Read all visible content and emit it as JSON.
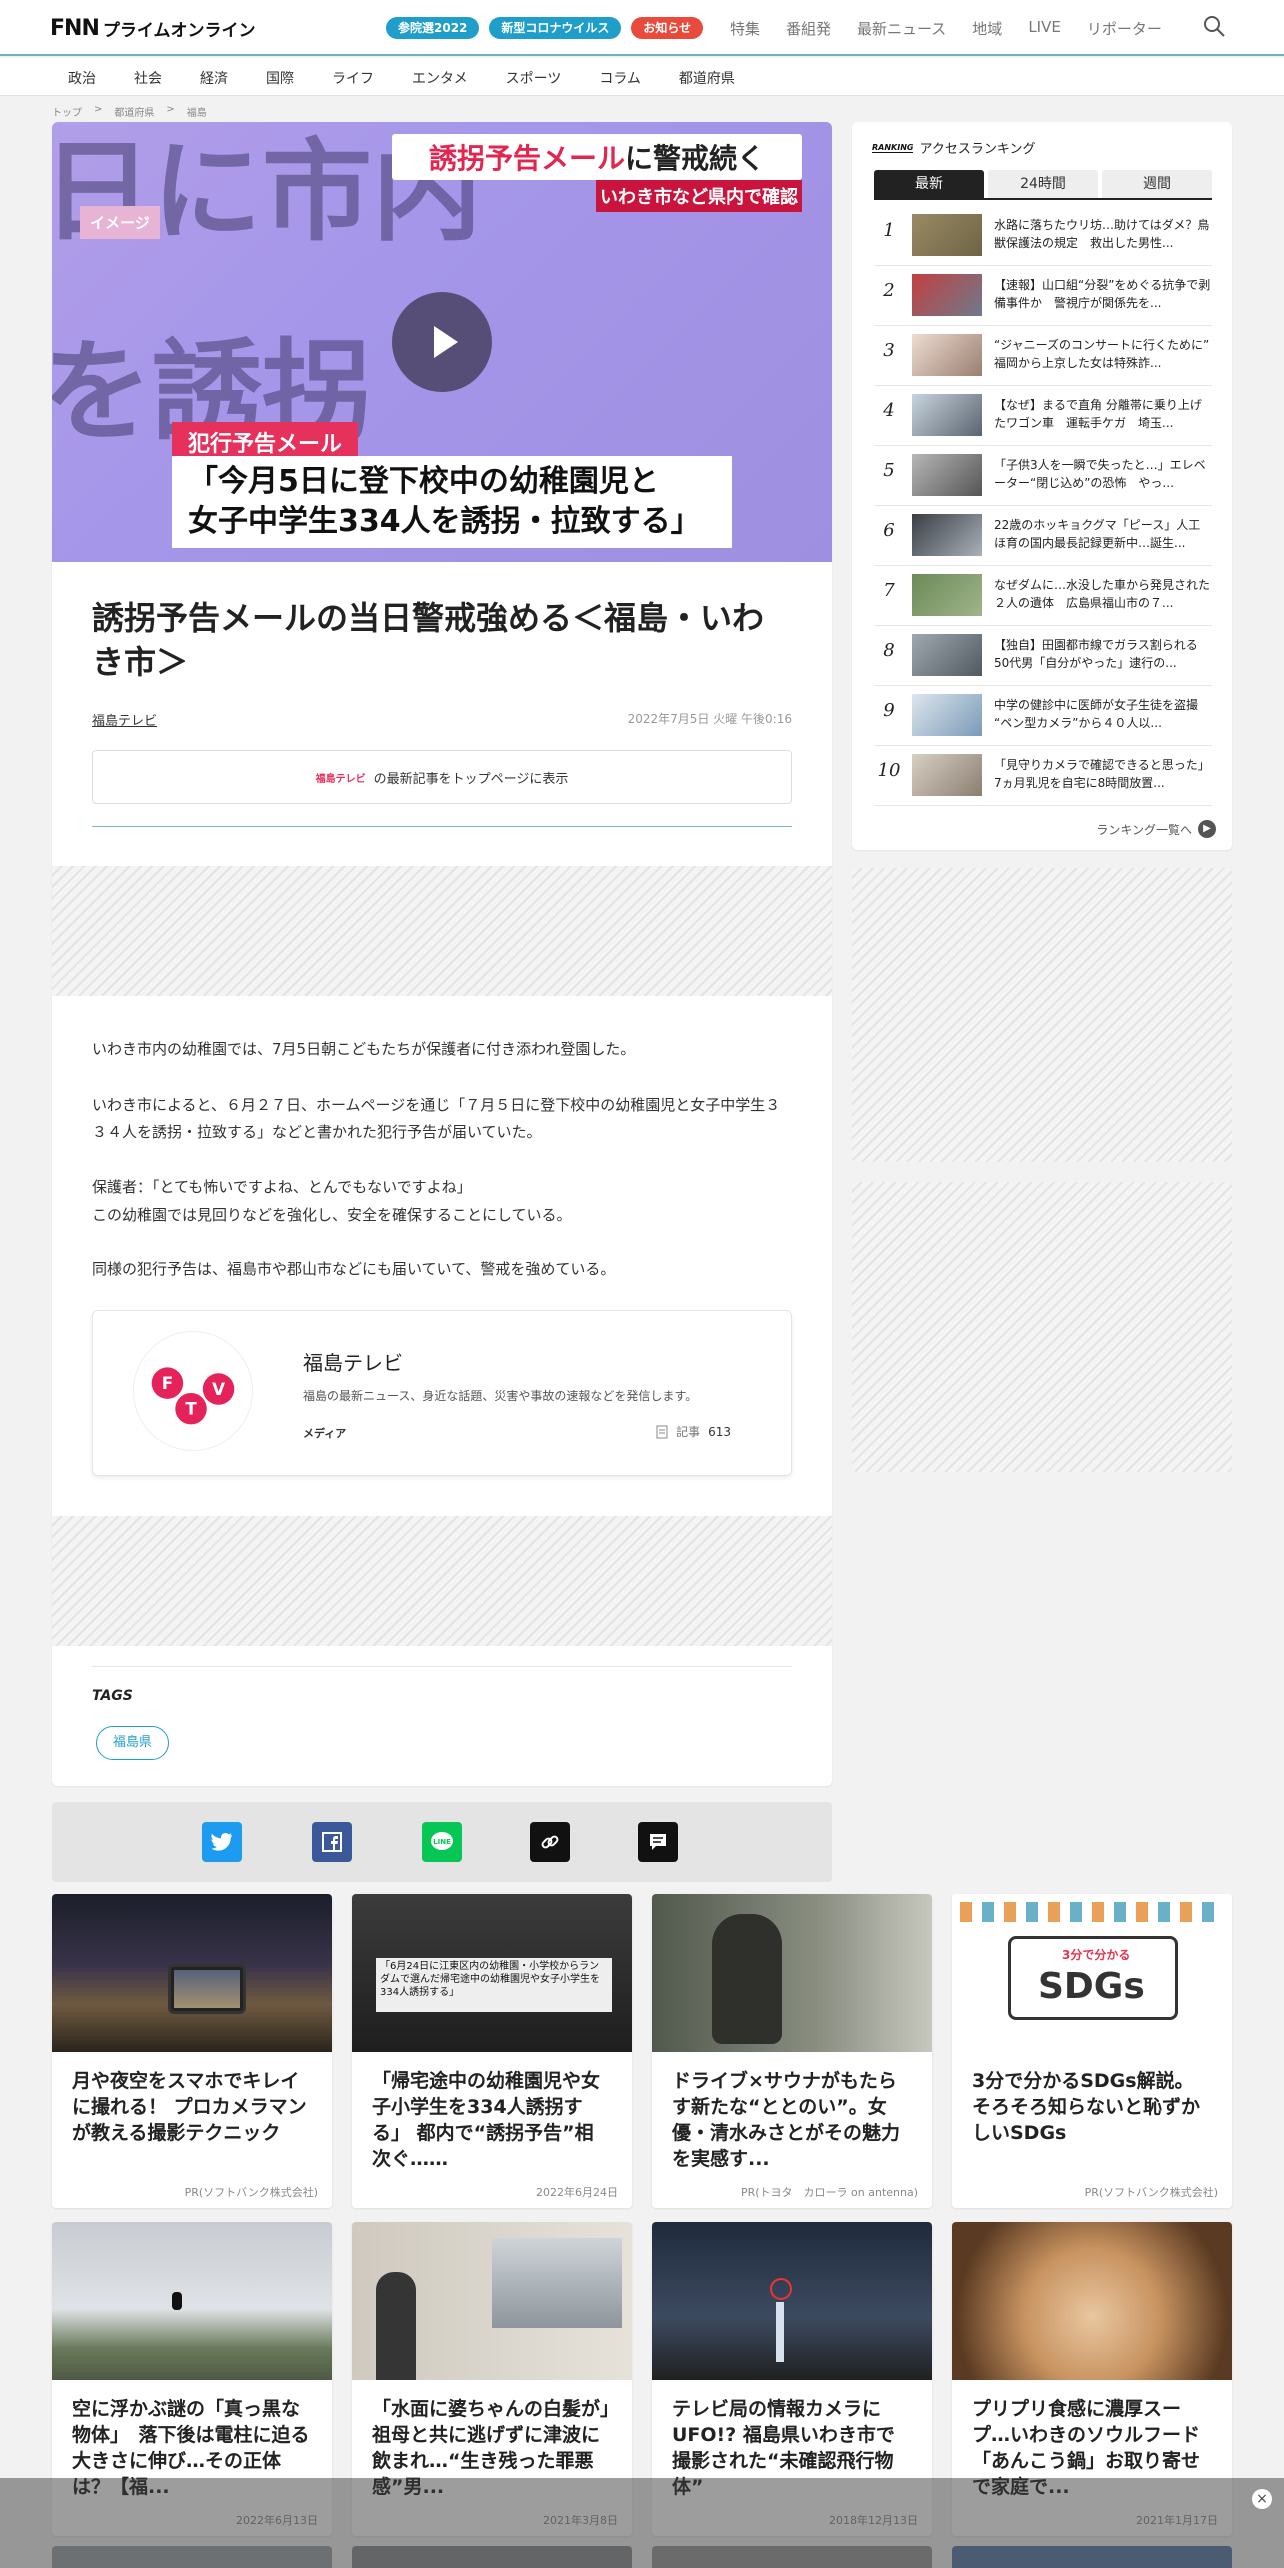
{
  "header": {
    "logo_fnn": "FNN",
    "logo_sub": "プライムオンライン",
    "pills": [
      "参院選2022",
      "新型コロナウイルス",
      "お知らせ"
    ],
    "nav": [
      "特集",
      "番組発",
      "最新ニュース",
      "地域",
      "LIVE",
      "リポーター"
    ]
  },
  "categories": [
    "政治",
    "社会",
    "経済",
    "国際",
    "ライフ",
    "エンタメ",
    "スポーツ",
    "コラム",
    "都道府県"
  ],
  "breadcrumb": [
    "トップ",
    ">",
    "都道府県",
    ">",
    "福島"
  ],
  "hero": {
    "bg_text_1": "日に市内",
    "bg_text_2": "を誘拐",
    "banner_red": "誘拐予告メール",
    "banner_black": "に警戒続く",
    "banner_sub": "いわき市など県内で確認",
    "image_tag": "イメージ",
    "crime_label": "犯行予告メール",
    "caption": "「今月5日に登下校中の幼稚園児と　女子中学生334人を誘拐・拉致する」"
  },
  "article": {
    "title": "誘拐予告メールの当日警戒強める＜福島・いわき市＞",
    "source": "福島テレビ",
    "date": "2022年7月5日 火曜 午後0:16",
    "top_link_logo": "福島テレビ",
    "top_link_text": "の最新記事をトップページに表示",
    "paragraphs": [
      "いわき市内の幼稚園では、7月5日朝こどもたちが保護者に付き添われ登園した。",
      "いわき市によると、６月２７日、ホームページを通じ「７月５日に登下校中の幼稚園児と女子中学生３３４人を誘拐・拉致する」などと書かれた犯行予告が届いていた。",
      "保護者：「とても怖いですよね、とんでもないですよね」",
      "この幼稚園では見回りなどを強化し、安全を確保することにしている。",
      "同様の犯行予告は、福島市や郡山市などにも届いていて、警戒を強めている。"
    ]
  },
  "media": {
    "name": "福島テレビ",
    "desc": "福島の最新ニュース、身近な話題、災害や事故の速報などを発信します。",
    "type": "メディア",
    "count_label": "記事",
    "count": "613"
  },
  "tags": {
    "title": "TAGS",
    "items": [
      "福島県"
    ]
  },
  "ranking": {
    "title_en": "RANKING",
    "title_jp": "アクセスランキング",
    "tabs": [
      "最新",
      "24時間",
      "週間"
    ],
    "items": [
      {
        "n": "1",
        "title": "水路に落ちたウリ坊…助けてはダメ？鳥獣保護法の規定　救出した男性..."
      },
      {
        "n": "2",
        "title": "【速報】山口組“分裂”をめぐる抗争で剥備事件か　警視庁が関係先を..."
      },
      {
        "n": "3",
        "title": "“ジャニーズのコンサートに行くために”　福岡から上京した女は特殊詐..."
      },
      {
        "n": "4",
        "title": "【なぜ】まるで直角 分離帯に乗り上げたワゴン車　運転手ケガ　埼玉..."
      },
      {
        "n": "5",
        "title": "「子供3人を一瞬で失ったと…」エレベーター“閉じ込め”の恐怖　やっ..."
      },
      {
        "n": "6",
        "title": "22歳のホッキョクグマ「ピース」人工ほ育の国内最長記録更新中…誕生..."
      },
      {
        "n": "7",
        "title": "なぜダムに…水没した車から発見された２人の遺体　広島県福山市の７..."
      },
      {
        "n": "8",
        "title": "【独自】田園都市線でガラス割られる 50代男「自分がやった」逮行の..."
      },
      {
        "n": "9",
        "title": "中学の健診中に医師が女子生徒を盗撮 “ペン型カメラ”から４０人以..."
      },
      {
        "n": "10",
        "title": "「見守りカメラで確認できると思った」7ヵ月乳児を自宅に8時間放置..."
      }
    ],
    "more": "ランキング一覧へ"
  },
  "cards": [
    {
      "title": "月や夜空をスマホでキレイに撮れる！ プロカメラマンが教える撮影テクニック",
      "meta": "PR(ソフトバンク株式会社)"
    },
    {
      "title": "「帰宅途中の幼稚園児や女子小学生を334人誘拐する」 都内で“誘拐予告”相次ぐ……",
      "meta": "2022年6月24日",
      "img_text": "「6月24日に江東区内の幼稚園・小学校からランダムで選んだ帰宅途中の幼稚園児や女子小学生を334人誘拐する」"
    },
    {
      "title": "ドライブ×サウナがもたらす新たな“ととのい”。女優・清水みさとがその魅力を実感す...",
      "meta": "PR(トヨタ　カローラ on antenna)"
    },
    {
      "title": "3分で分かるSDGs解説。そろそろ知らないと恥ずかしいSDGs",
      "meta": "PR(ソフトバンク株式会社)",
      "img_text": "3分で分かる",
      "img_text2": "SDGs"
    },
    {
      "title": "空に浮かぶ謎の「真っ黒な物体」　落下後は電柱に迫る大きさに伸び…その正体は？【福...",
      "meta": "2022年6月13日"
    },
    {
      "title": "「水面に婆ちゃんの白髪が」祖母と共に逃げずに津波に飲まれ…“生き残った罪悪感”男...",
      "meta": "2021年3月8日"
    },
    {
      "title": "テレビ局の情報カメラにUFO!? 福島県いわき市で撮影された“未確認飛行物体”",
      "meta": "2018年12月13日"
    },
    {
      "title": "プリプリ食感に濃厚スープ…いわきのソウルフード「あんこう鍋」お取り寄せで家庭で...",
      "meta": "2021年1月17日"
    }
  ],
  "overlay": {
    "close": "×"
  }
}
